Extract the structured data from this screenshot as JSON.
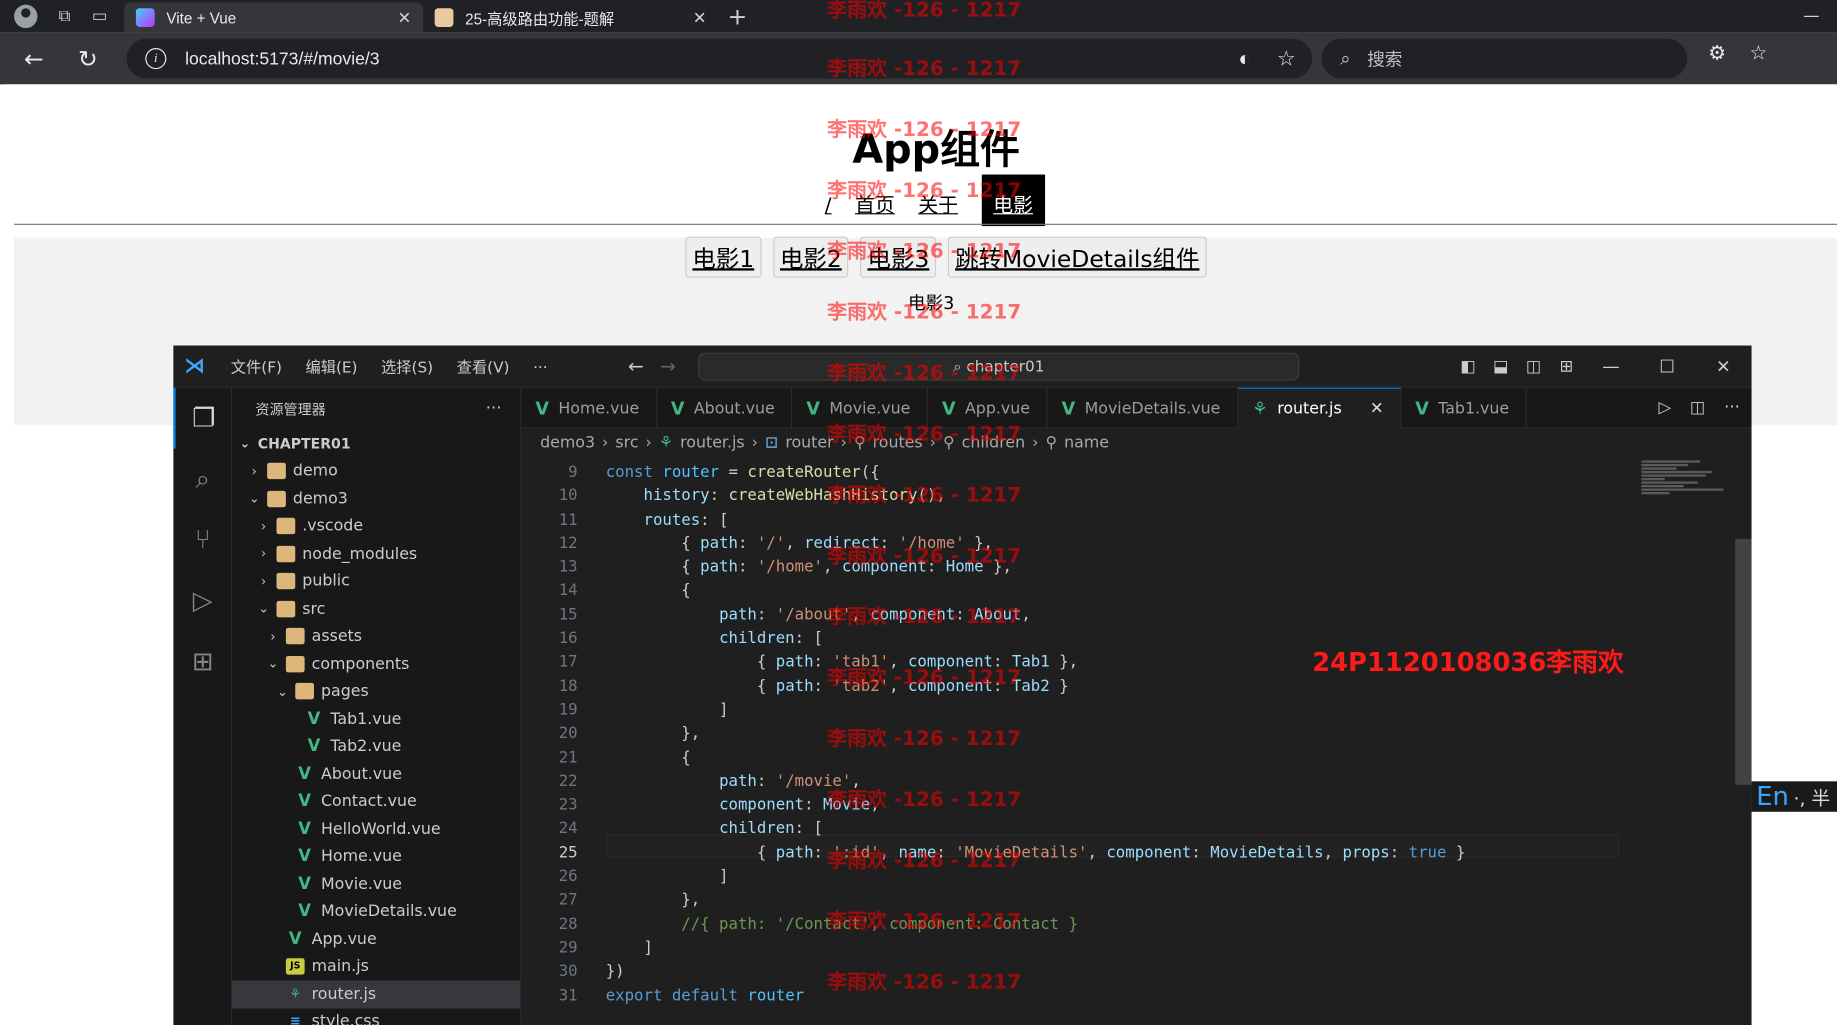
{
  "browser": {
    "tabs": [
      {
        "title": "Vite + Vue",
        "active": true
      },
      {
        "title": "25-高级路由功能-题解",
        "active": false
      }
    ],
    "url": "localhost:5173/#/movie/3",
    "search_placeholder": "搜索"
  },
  "app": {
    "title": "App组件",
    "nav": [
      "/",
      "首页",
      "关于",
      "电影"
    ],
    "nav_active": "电影",
    "movie_links": [
      "电影1",
      "电影2",
      "电影3",
      "跳转MovieDetails组件"
    ],
    "movie_output": "电影3"
  },
  "vscode": {
    "menu": [
      "文件(F)",
      "编辑(E)",
      "选择(S)",
      "查看(V)",
      "···"
    ],
    "command_center": "chapter01",
    "explorer_title": "资源管理器",
    "tree": [
      {
        "label": "CHAPTER01",
        "depth": 0,
        "chevron": "open",
        "icon": "none"
      },
      {
        "label": "demo",
        "depth": 1,
        "chevron": "closed",
        "icon": "folder"
      },
      {
        "label": "demo3",
        "depth": 1,
        "chevron": "open",
        "icon": "folder"
      },
      {
        "label": ".vscode",
        "depth": 2,
        "chevron": "closed",
        "icon": "folder"
      },
      {
        "label": "node_modules",
        "depth": 2,
        "chevron": "closed",
        "icon": "folder"
      },
      {
        "label": "public",
        "depth": 2,
        "chevron": "closed",
        "icon": "folder"
      },
      {
        "label": "src",
        "depth": 2,
        "chevron": "open",
        "icon": "folder"
      },
      {
        "label": "assets",
        "depth": 3,
        "chevron": "closed",
        "icon": "folder"
      },
      {
        "label": "components",
        "depth": 3,
        "chevron": "open",
        "icon": "folder"
      },
      {
        "label": "pages",
        "depth": 4,
        "chevron": "open",
        "icon": "folder"
      },
      {
        "label": "Tab1.vue",
        "depth": 5,
        "chevron": "none",
        "icon": "vue"
      },
      {
        "label": "Tab2.vue",
        "depth": 5,
        "chevron": "none",
        "icon": "vue"
      },
      {
        "label": "About.vue",
        "depth": 4,
        "chevron": "none",
        "icon": "vue"
      },
      {
        "label": "Contact.vue",
        "depth": 4,
        "chevron": "none",
        "icon": "vue"
      },
      {
        "label": "HelloWorld.vue",
        "depth": 4,
        "chevron": "none",
        "icon": "vue"
      },
      {
        "label": "Home.vue",
        "depth": 4,
        "chevron": "none",
        "icon": "vue"
      },
      {
        "label": "Movie.vue",
        "depth": 4,
        "chevron": "none",
        "icon": "vue"
      },
      {
        "label": "MovieDetails.vue",
        "depth": 4,
        "chevron": "none",
        "icon": "vue"
      },
      {
        "label": "App.vue",
        "depth": 3,
        "chevron": "none",
        "icon": "vue"
      },
      {
        "label": "main.js",
        "depth": 3,
        "chevron": "none",
        "icon": "js"
      },
      {
        "label": "router.js",
        "depth": 3,
        "chevron": "none",
        "icon": "router",
        "selected": true
      },
      {
        "label": "style.css",
        "depth": 3,
        "chevron": "none",
        "icon": "css"
      }
    ],
    "editor_tabs": [
      {
        "label": "Home.vue",
        "active": false
      },
      {
        "label": "About.vue",
        "active": false
      },
      {
        "label": "Movie.vue",
        "active": false
      },
      {
        "label": "App.vue",
        "active": false
      },
      {
        "label": "MovieDetails.vue",
        "active": false
      },
      {
        "label": "router.js",
        "active": true
      },
      {
        "label": "Tab1.vue",
        "active": false
      }
    ],
    "breadcrumb": [
      "demo3",
      "src",
      "router.js",
      "router",
      "routes",
      "children",
      "name"
    ],
    "line_numbers": [
      9,
      10,
      11,
      12,
      13,
      14,
      15,
      16,
      17,
      18,
      19,
      20,
      21,
      22,
      23,
      24,
      25,
      26,
      27,
      28,
      29,
      30,
      31
    ],
    "current_line": 25,
    "code_lines": [
      "const router = createRouter({",
      "    history: createWebHashHistory(),",
      "    routes: [",
      "        { path: '/', redirect: '/home' },",
      "        { path: '/home', component: Home },",
      "        {",
      "            path: '/about', component: About,",
      "            children: [",
      "                { path: 'tab1', component: Tab1 },",
      "                { path: 'tab2', component: Tab2 }",
      "            ]",
      "        },",
      "        {",
      "            path: '/movie',",
      "            component: Movie,",
      "            children: [",
      "                { path: ':id', name: 'MovieDetails', component: MovieDetails, props: true }",
      "            ]",
      "        },",
      "        //{ path: '/Contact', component: Contact }",
      "    ]",
      "})",
      "export default router"
    ]
  },
  "overlay": {
    "watermark": "李雨欢 -126 - 1217",
    "stamp": "24P1120108036李雨欢",
    "ime": "En",
    "ime_extra": "·, 半"
  },
  "colors": {
    "vue": "#41b883",
    "accent": "#0078d4",
    "watermark": "#ff0000"
  }
}
